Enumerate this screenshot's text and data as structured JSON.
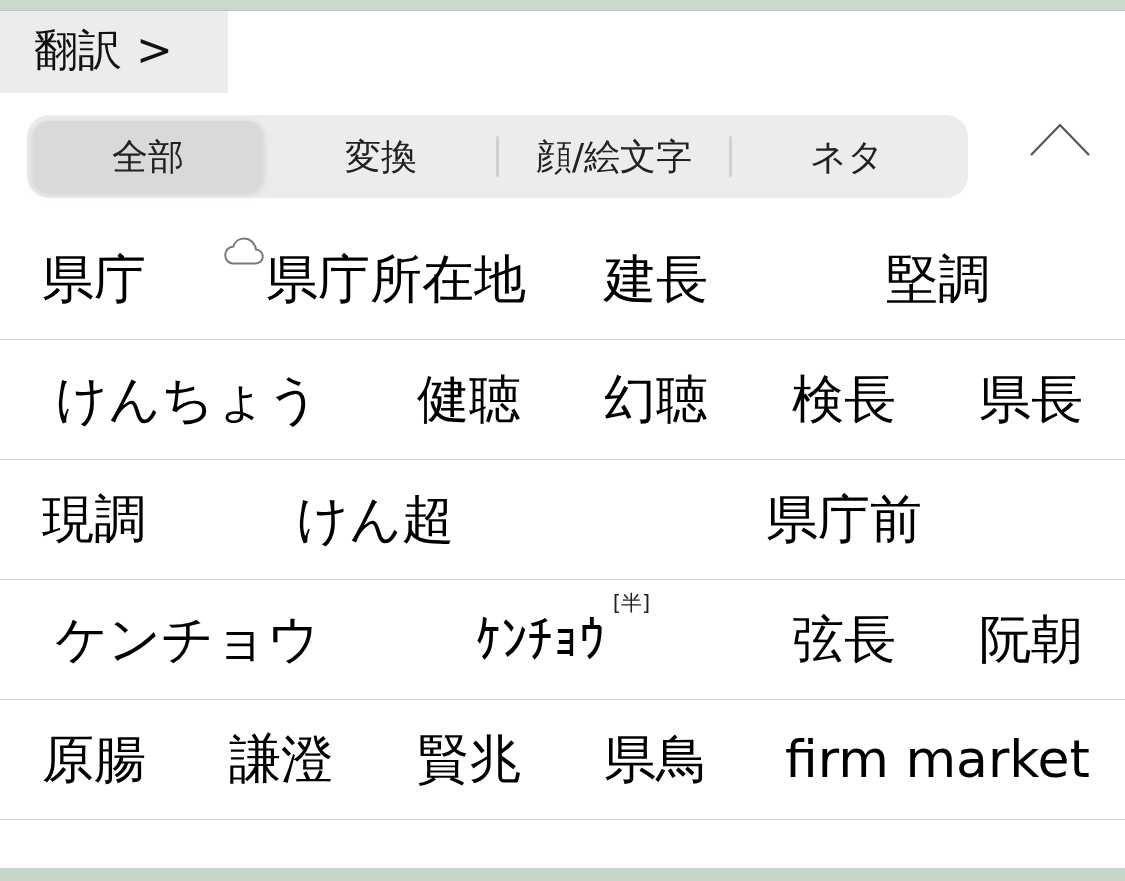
{
  "translate_button": {
    "label": "翻訳 >"
  },
  "tabs": [
    {
      "label": "全部",
      "selected": true
    },
    {
      "label": "変換",
      "selected": false
    },
    {
      "label": "顔/絵文字",
      "selected": false
    },
    {
      "label": "ネタ",
      "selected": false
    }
  ],
  "candidate_rows": [
    {
      "candidates": [
        {
          "text": "県庁",
          "cloud": false
        },
        {
          "text": "県庁所在地",
          "cloud": true
        },
        {
          "text": "建長",
          "cloud": false
        },
        {
          "text": "堅調",
          "cloud": false
        }
      ]
    },
    {
      "candidates": [
        {
          "text": "けんちょう",
          "cloud": false
        },
        {
          "text": "健聴",
          "cloud": false
        },
        {
          "text": "幻聴",
          "cloud": false
        },
        {
          "text": "検長",
          "cloud": false
        },
        {
          "text": "県長",
          "cloud": false
        }
      ]
    },
    {
      "candidates": [
        {
          "text": "現調",
          "cloud": false
        },
        {
          "text": "けん超",
          "cloud": false
        },
        {
          "text": "県庁前",
          "cloud": false
        }
      ]
    },
    {
      "candidates": [
        {
          "text": "ケンチョウ",
          "cloud": false
        },
        {
          "text": "ｹﾝﾁｮｳ",
          "cloud": false,
          "tag": "[半]"
        },
        {
          "text": "弦長",
          "cloud": false
        },
        {
          "text": "阮朝",
          "cloud": false
        }
      ]
    },
    {
      "candidates": [
        {
          "text": "原腸",
          "cloud": false
        },
        {
          "text": "謙澄",
          "cloud": false
        },
        {
          "text": "賢兆",
          "cloud": false
        },
        {
          "text": "県鳥",
          "cloud": false
        },
        {
          "text": "firm market",
          "cloud": false
        }
      ]
    }
  ]
}
